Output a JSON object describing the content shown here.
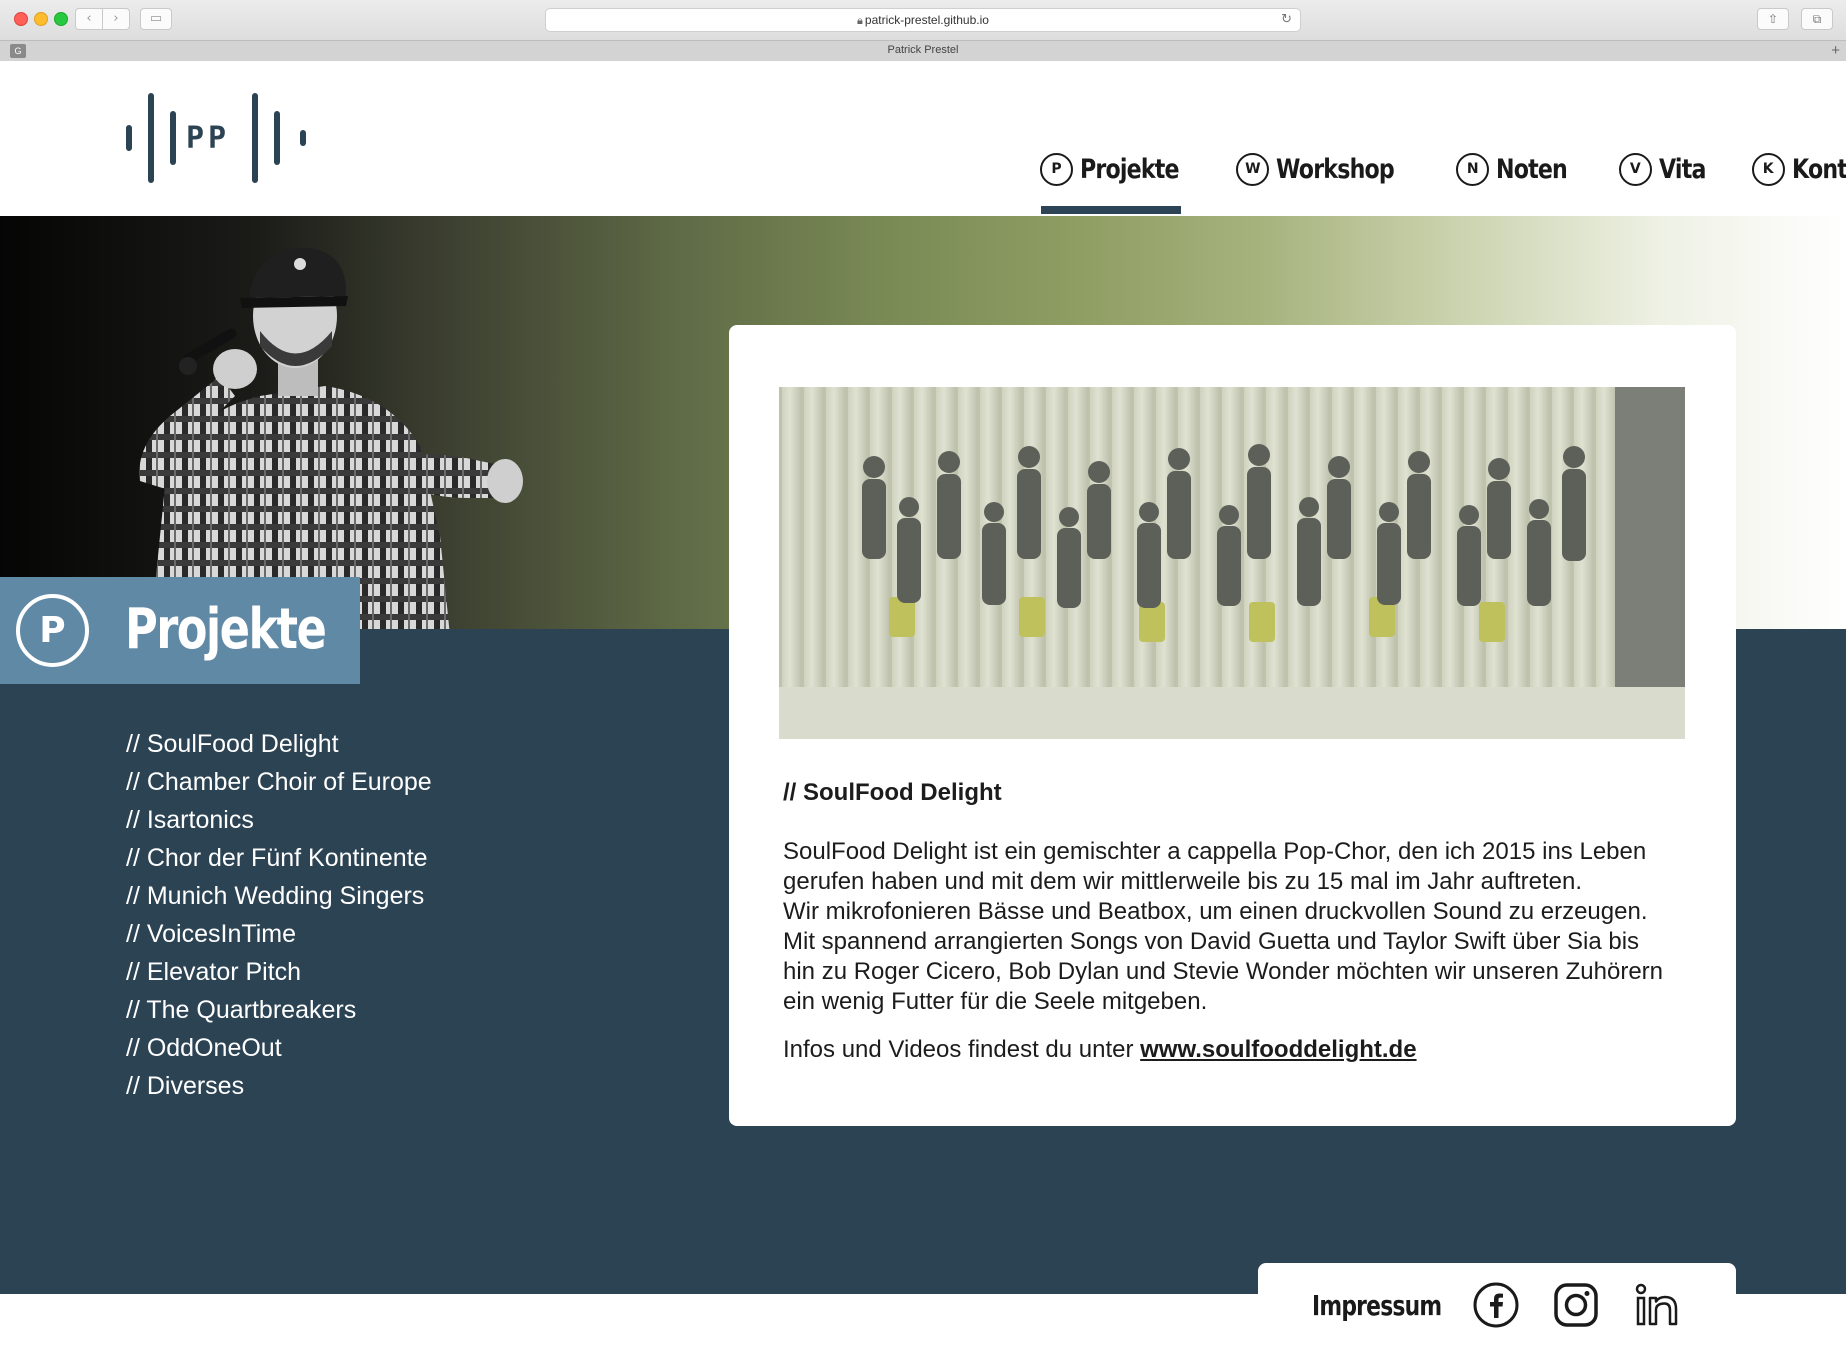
{
  "browser": {
    "url": "patrick-prestel.github.io",
    "tab_title": "Patrick Prestel",
    "tab_favicon": "G"
  },
  "logo": {
    "letters": "PP"
  },
  "nav": {
    "items": [
      {
        "letter": "P",
        "label": "Projekte",
        "active": true
      },
      {
        "letter": "W",
        "label": "Workshop",
        "active": false
      },
      {
        "letter": "N",
        "label": "Noten",
        "active": false
      },
      {
        "letter": "V",
        "label": "Vita",
        "active": false
      },
      {
        "letter": "K",
        "label": "Kontakt",
        "active": false
      }
    ]
  },
  "section": {
    "letter": "P",
    "title": "Projekte"
  },
  "projects": [
    "// SoulFood Delight",
    "// Chamber Choir of Europe",
    "// Isartonics",
    "// Chor der Fünf Kontinente",
    "// Munich Wedding Singers",
    "// VoicesInTime",
    "// Elevator Pitch",
    "// The Quartbreakers",
    "// OddOneOut",
    "// Diverses"
  ],
  "card": {
    "heading": "// SoulFood Delight",
    "paragraph_lines": [
      "SoulFood Delight ist ein gemischter a cappella Pop-Chor, den ich 2015 ins Leben",
      "gerufen haben und mit dem wir mittlerweile bis zu 15 mal im Jahr auftreten.",
      "Wir mikrofonieren Bässe und Beatbox, um einen druckvollen Sound zu erzeugen.",
      "Mit spannend arrangierten Songs von David Guetta und Taylor Swift über Sia bis",
      "hin zu Roger Cicero, Bob Dylan und Stevie Wonder möchten wir unseren Zuhörern",
      "ein wenig Futter für die Seele mitgeben."
    ],
    "info_prefix": "Infos und Videos findest du unter ",
    "info_link": "www.soulfooddelight.de"
  },
  "footer": {
    "impressum": "Impressum",
    "social": [
      "facebook-icon",
      "instagram-icon",
      "linkedin-icon"
    ]
  },
  "colors": {
    "dark_blue": "#2c4354",
    "section_tab": "#6089a5",
    "text": "#1c1c1c"
  }
}
